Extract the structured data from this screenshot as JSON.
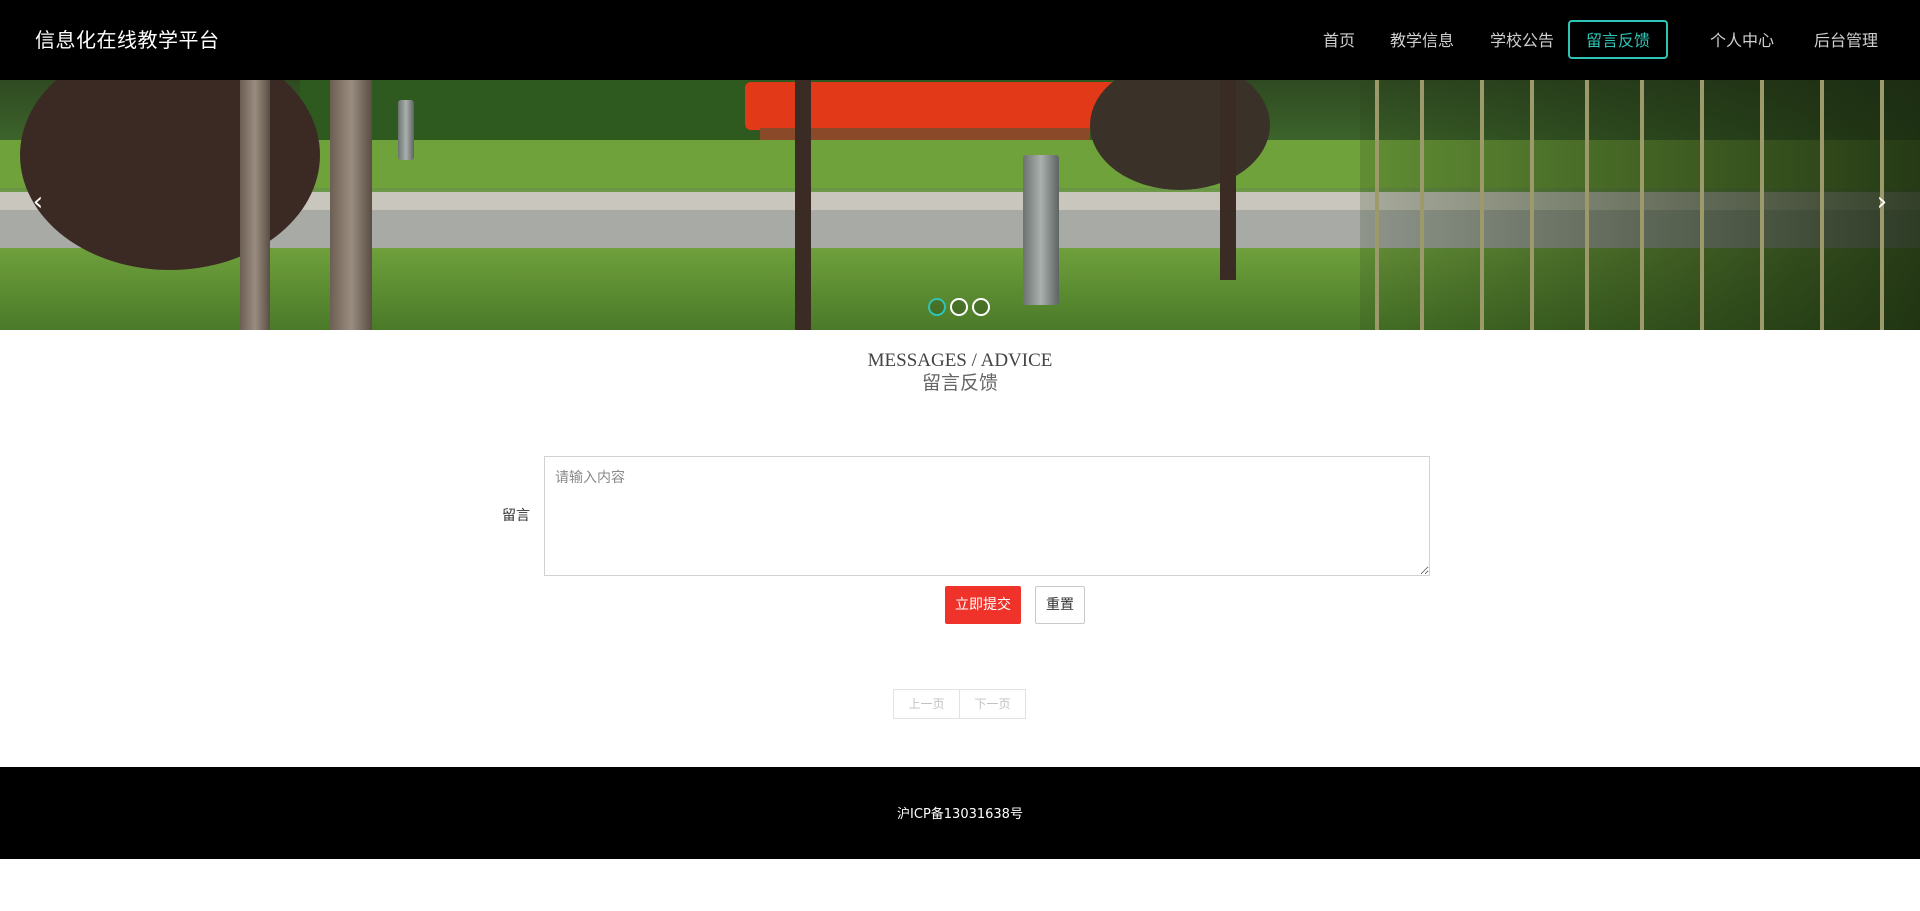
{
  "header": {
    "brand": "信息化在线教学平台",
    "nav": [
      {
        "label": "首页",
        "active": false
      },
      {
        "label": "教学信息",
        "active": false
      },
      {
        "label": "学校公告",
        "active": false
      },
      {
        "label": "留言反馈",
        "active": true
      },
      {
        "label": "个人中心",
        "active": false
      },
      {
        "label": "后台管理",
        "active": false
      }
    ]
  },
  "banner": {
    "prev_icon": "chevron-left-icon",
    "next_icon": "chevron-right-icon",
    "prev_glyph": "‹",
    "next_glyph": "›",
    "slides_count": 3,
    "active_slide": 1
  },
  "section": {
    "title_en": "MESSAGES / ADVICE",
    "title_cn": "留言反馈"
  },
  "form": {
    "label": "留言",
    "placeholder": "请输入内容",
    "value": "",
    "submit_label": "立即提交",
    "reset_label": "重置"
  },
  "pager": {
    "prev_label": "上一页",
    "next_label": "下一页"
  },
  "footer": {
    "text": "沪ICP备13031638号"
  },
  "colors": {
    "accent": "#2ec4b6",
    "submit": "#f0332a",
    "header_bg": "#000000"
  }
}
